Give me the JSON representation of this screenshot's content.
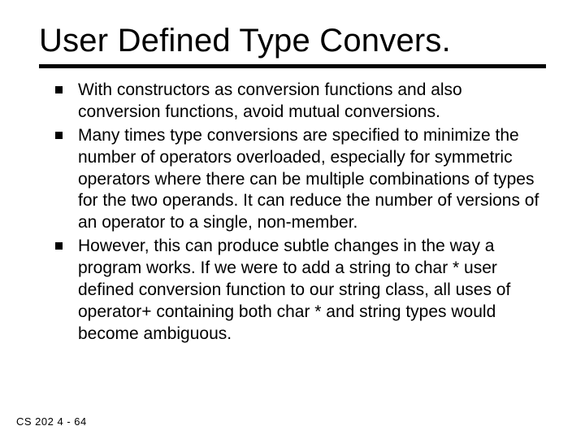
{
  "title": "User Defined Type Convers.",
  "bullets": [
    "With constructors as conversion functions and also conversion functions, avoid mutual conversions.",
    "Many times type conversions are specified to minimize the number of operators overloaded, especially for symmetric operators where there can be multiple combinations of types for the two operands. It can reduce the number of versions of an operator to a single, non-member.",
    "However, this can produce subtle changes in the way a program works. If we were to add a string to char * user defined conversion function to our string class, all uses of operator+ containing both char * and string types would become ambiguous."
  ],
  "footer": "CS 202   4 - 64"
}
